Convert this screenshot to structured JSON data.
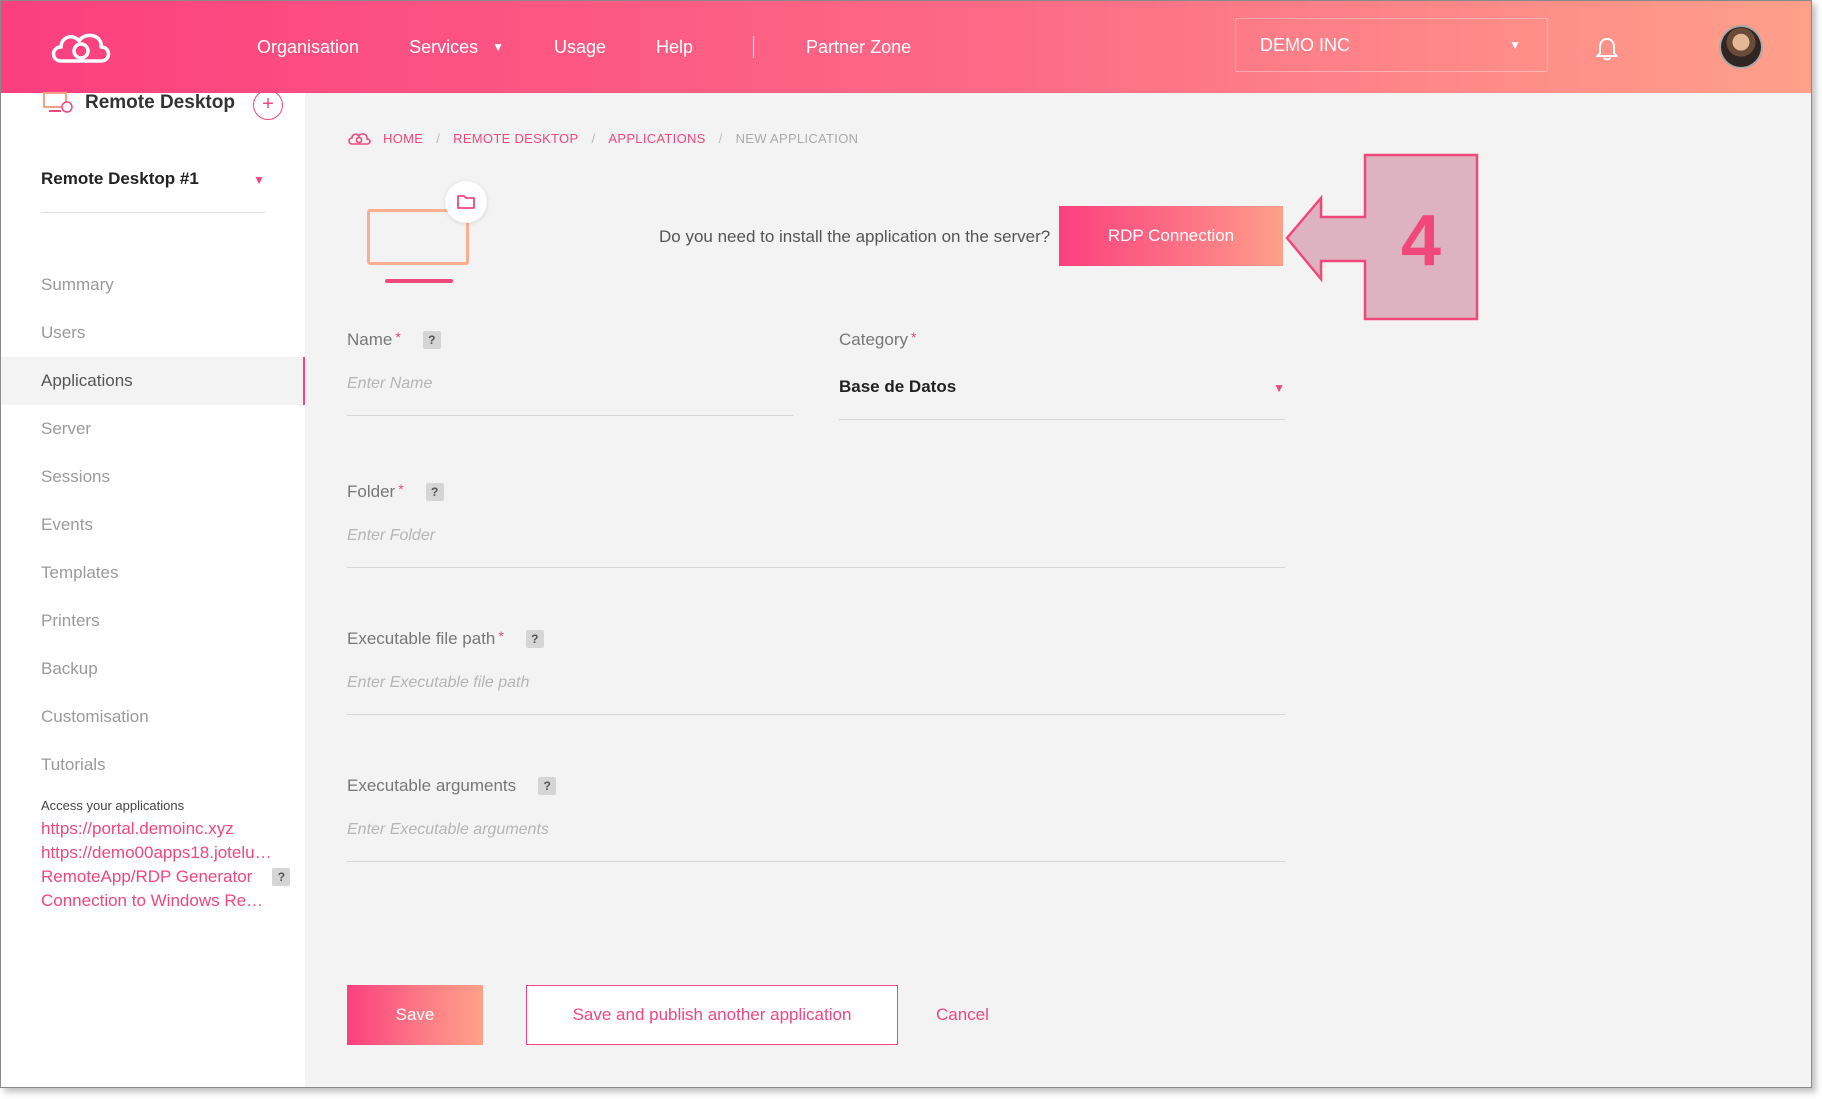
{
  "colors": {
    "brand": "#f0477d",
    "gradient_start": "#fb3f7f",
    "gradient_end": "#fea08a",
    "callout_fill": "#ddb3c2",
    "callout_text": "#f0477d"
  },
  "header": {
    "nav": [
      {
        "label": "Organisation"
      },
      {
        "label": "Services"
      },
      {
        "label": "Usage"
      },
      {
        "label": "Help"
      },
      {
        "label": "Partner Zone"
      }
    ],
    "org_select": "DEMO INC"
  },
  "sidebar": {
    "title": "Remote Desktop",
    "selected_desktop": "Remote Desktop #1",
    "menu": [
      {
        "label": "Summary"
      },
      {
        "label": "Users"
      },
      {
        "label": "Applications"
      },
      {
        "label": "Server"
      },
      {
        "label": "Sessions"
      },
      {
        "label": "Events"
      },
      {
        "label": "Templates"
      },
      {
        "label": "Printers"
      },
      {
        "label": "Backup"
      },
      {
        "label": "Customisation"
      },
      {
        "label": "Tutorials"
      }
    ],
    "access_title": "Access your applications",
    "links": [
      "https://portal.demoinc.xyz",
      "https://demo00apps18.jotelul…",
      "RemoteApp/RDP Generator",
      "Connection to Windows Rem…"
    ]
  },
  "breadcrumb": {
    "items": [
      "HOME",
      "REMOTE DESKTOP",
      "APPLICATIONS"
    ],
    "current": "NEW APPLICATION",
    "separator": "/"
  },
  "install": {
    "question": "Do you need to install the application on the server?",
    "button": "RDP Connection"
  },
  "callout": {
    "number": "4"
  },
  "form": {
    "help_mark": "?",
    "required_mark": "*",
    "name": {
      "label": "Name",
      "placeholder": "Enter Name"
    },
    "category": {
      "label": "Category",
      "value": "Base de Datos"
    },
    "folder": {
      "label": "Folder",
      "placeholder": "Enter Folder"
    },
    "exe_path": {
      "label": "Executable file path",
      "placeholder": "Enter Executable file path"
    },
    "exe_args": {
      "label": "Executable arguments",
      "placeholder": "Enter Executable arguments"
    }
  },
  "actions": {
    "save": "Save",
    "publish": "Save and publish another application",
    "cancel": "Cancel"
  }
}
